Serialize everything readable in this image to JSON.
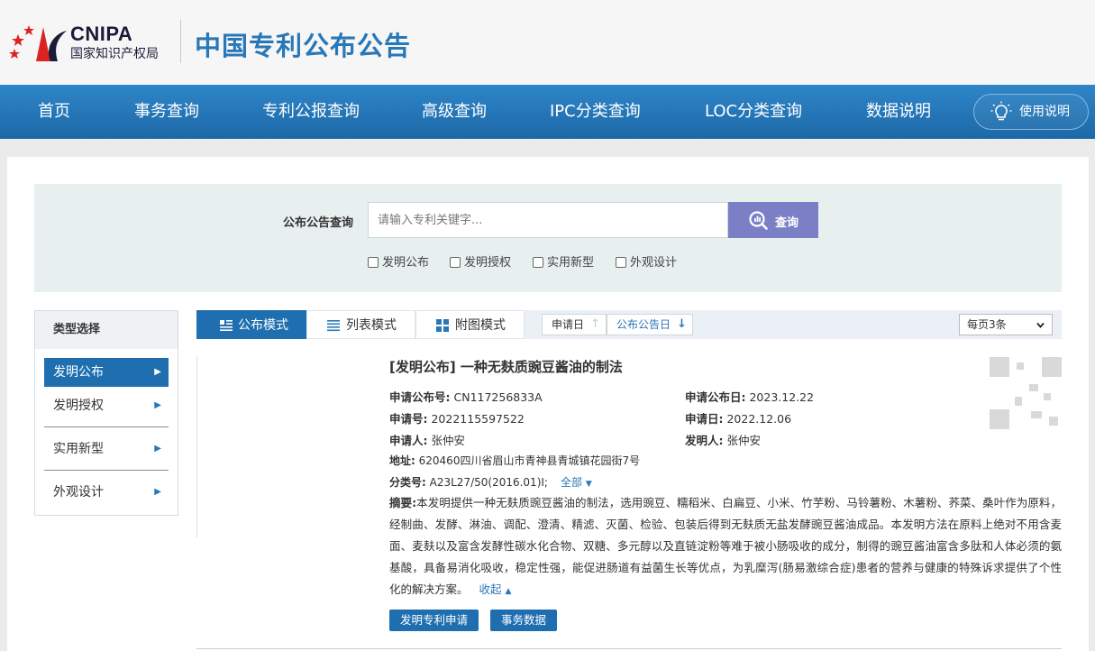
{
  "header": {
    "logo_en": "CNIPA",
    "logo_cn": "国家知识产权局",
    "site_title": "中国专利公布公告"
  },
  "nav": {
    "items": [
      "首页",
      "事务查询",
      "专利公报查询",
      "高级查询",
      "IPC分类查询",
      "LOC分类查询",
      "数据说明"
    ],
    "help": "使用说明"
  },
  "search": {
    "label": "公布公告查询",
    "placeholder": "请输入专利关键字...",
    "button": "查询",
    "checkboxes": [
      "发明公布",
      "发明授权",
      "实用新型",
      "外观设计"
    ]
  },
  "sidebar": {
    "title": "类型选择",
    "items": [
      "发明公布",
      "发明授权",
      "实用新型",
      "外观设计"
    ],
    "active_index": 0
  },
  "view": {
    "tabs": [
      "公布模式",
      "列表模式",
      "附图模式"
    ],
    "active_index": 0,
    "sort": [
      "申请日",
      "公布公告日"
    ],
    "per_page": "每页3条"
  },
  "result": {
    "title": "[发明公布] 一种无麸质豌豆酱油的制法",
    "pub_no_label": "申请公布号:",
    "pub_no": "CN117256833A",
    "pub_date_label": "申请公布日:",
    "pub_date": "2023.12.22",
    "app_no_label": "申请号:",
    "app_no": "2022115597522",
    "app_date_label": "申请日:",
    "app_date": "2022.12.06",
    "applicant_label": "申请人:",
    "applicant": "张仲安",
    "inventor_label": "发明人:",
    "inventor": "张仲安",
    "address_label": "地址:",
    "address": "620460四川省眉山市青神县青城镇花园街7号",
    "class_label": "分类号:",
    "class": "A23L27/50(2016.01)I;",
    "all_label": "全部",
    "abstract_label": "摘要:",
    "abstract": "本发明提供一种无麸质豌豆酱油的制法，选用豌豆、糯稻米、白扁豆、小米、竹芋粉、马铃薯粉、木薯粉、荞菜、桑叶作为原料，经制曲、发酵、淋油、调配、澄清、精滤、灭菌、检验、包装后得到无麸质无盐发酵豌豆酱油成品。本发明方法在原料上绝对不用含麦面、麦麸以及富含发酵性碳水化合物、双糖、多元醇以及直链淀粉等难于被小肠吸收的成分，制得的豌豆酱油富含多肽和人体必须的氨基酸，具备易消化吸收，稳定性强，能促进肠道有益菌生长等优点，为乳糜泻(肠易激综合症)患者的营养与健康的特殊诉求提供了个性化的解决方案。",
    "collapse": "收起",
    "buttons": [
      "发明专利申请",
      "事务数据"
    ]
  },
  "colors": {
    "nav_blue": "#1f6fb0",
    "title_blue": "#2a77b8",
    "search_btn": "#7a7fc6",
    "search_bg": "#e7f0ef"
  }
}
